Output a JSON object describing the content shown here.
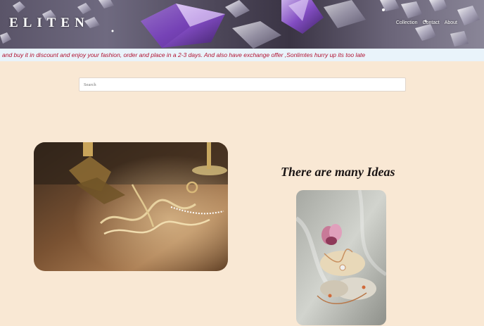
{
  "brand": {
    "logo": "ELITEN"
  },
  "nav": {
    "items": [
      "Collection",
      "Contact",
      "About"
    ]
  },
  "marquee": {
    "text": "and buy it in discount and enjoy your fashion, order and place in a 2-3 days. And also have exchange offer ,Sonlimtes hurry up its too late"
  },
  "search": {
    "placeholder": "Search",
    "value": ""
  },
  "section": {
    "headline": "There are many Ideas"
  },
  "colors": {
    "background": "#f9e8d4",
    "marquee_text": "#b01030",
    "marquee_bg": "#e9f3fa"
  },
  "images": [
    "gold-jewelry-on-wooden-table",
    "necklace-on-stones-with-flower"
  ]
}
